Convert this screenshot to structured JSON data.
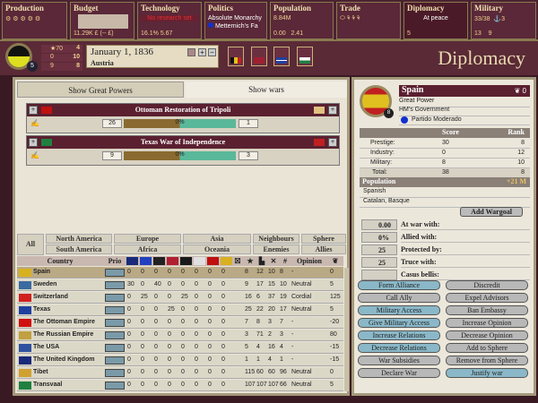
{
  "topbar": {
    "production": {
      "title": "Production"
    },
    "budget": {
      "title": "Budget",
      "value": "11.29K £ (-- £)"
    },
    "technology": {
      "title": "Technology",
      "research": "No research set",
      "literacy": "16.1%",
      "research_points": "5.67"
    },
    "politics": {
      "title": "Politics",
      "government": "Absolute Monarchy",
      "ruler": "Metternich's Fa"
    },
    "population": {
      "title": "Population",
      "total": "8.84M",
      "militancy": "0.00",
      "consciousness": "2.41"
    },
    "trade": {
      "title": "Trade"
    },
    "diplomacy": {
      "title": "Diplomacy",
      "status": "At peace",
      "diplomats": "5"
    },
    "military": {
      "title": "Military",
      "army": "33/38",
      "navy": "3",
      "brigades": "13",
      "leaders": "9"
    }
  },
  "nation": {
    "rank": "5",
    "prestige": "70",
    "prestige_rank": "4",
    "industry": "0",
    "industry_rank": "10",
    "military": "9",
    "military_rank": "8",
    "date": "January 1, 1836",
    "name": "Austria"
  },
  "screen_title": "Diplomacy",
  "tabs": [
    "Show Great Powers",
    "Show wars"
  ],
  "wars": [
    {
      "name": "Ottoman Restoration of Tripoli",
      "attackers": "26",
      "progress": "0%",
      "defenders": "1",
      "colors": [
        "#c01010",
        "#e0c080"
      ]
    },
    {
      "name": "Texas War of Independence",
      "attackers": "9",
      "progress": "0%",
      "defenders": "3",
      "colors": [
        "#208040",
        "#c02020"
      ]
    }
  ],
  "filters": {
    "all": "All",
    "north_america": "North America",
    "south_america": "South America",
    "europe": "Europe",
    "africa": "Africa",
    "asia": "Asia",
    "oceania": "Oceania",
    "neighbours": "Neighbours",
    "enemies": "Enemies",
    "sphere": "Sphere",
    "allies": "Allies"
  },
  "table": {
    "headers": {
      "country": "Country",
      "prio": "Prio",
      "opinion": "Opinion"
    },
    "gp_flag_colors": [
      "#1a2a7a",
      "#2040c0",
      "#222222",
      "#b02030",
      "#1a1a1a",
      "#e0e0e0",
      "#c01010",
      "#d8b020"
    ],
    "rows": [
      {
        "name": "Spain",
        "flag": "#d8b020",
        "vals": [
          "0",
          "0",
          "0",
          "0",
          "0",
          "0",
          "0",
          "0"
        ],
        "prestige": "8",
        "industry": "12",
        "military": "10",
        "rank": "8",
        "opinion": "-",
        "influence": "0"
      },
      {
        "name": "Sweden",
        "flag": "#3a6aa0",
        "vals": [
          "30",
          "0",
          "40",
          "0",
          "0",
          "0",
          "0",
          "0"
        ],
        "prestige": "9",
        "industry": "17",
        "military": "15",
        "rank": "10",
        "opinion": "Neutral",
        "influence": "5"
      },
      {
        "name": "Switzerland",
        "flag": "#d02020",
        "vals": [
          "0",
          "25",
          "0",
          "0",
          "25",
          "0",
          "0",
          "0"
        ],
        "prestige": "16",
        "industry": "6",
        "military": "37",
        "rank": "19",
        "opinion": "Cordial",
        "influence": "125"
      },
      {
        "name": "Texas",
        "flag": "#2040a0",
        "vals": [
          "0",
          "0",
          "0",
          "25",
          "0",
          "0",
          "0",
          "0"
        ],
        "prestige": "25",
        "industry": "22",
        "military": "20",
        "rank": "17",
        "opinion": "Neutral",
        "influence": "5"
      },
      {
        "name": "The Ottoman Empire",
        "flag": "#d01010",
        "vals": [
          "0",
          "0",
          "0",
          "0",
          "0",
          "0",
          "0",
          "0"
        ],
        "prestige": "7",
        "industry": "8",
        "military": "3",
        "rank": "7",
        "opinion": "-",
        "influence": "-20"
      },
      {
        "name": "The Russian Empire",
        "flag": "#c0a040",
        "vals": [
          "0",
          "0",
          "0",
          "0",
          "0",
          "0",
          "0",
          "0"
        ],
        "prestige": "3",
        "industry": "71",
        "military": "2",
        "rank": "3",
        "opinion": "-",
        "influence": "80"
      },
      {
        "name": "The USA",
        "flag": "#3050a0",
        "vals": [
          "0",
          "0",
          "0",
          "0",
          "0",
          "0",
          "0",
          "0"
        ],
        "prestige": "5",
        "industry": "4",
        "military": "16",
        "rank": "4",
        "opinion": "-",
        "influence": "-15"
      },
      {
        "name": "The United Kingdom",
        "flag": "#1a2a7a",
        "vals": [
          "0",
          "0",
          "0",
          "0",
          "0",
          "0",
          "0",
          "0"
        ],
        "prestige": "1",
        "industry": "1",
        "military": "4",
        "rank": "1",
        "opinion": "-",
        "influence": "-15"
      },
      {
        "name": "Tibet",
        "flag": "#d0a030",
        "vals": [
          "0",
          "0",
          "0",
          "0",
          "0",
          "0",
          "0",
          "0"
        ],
        "prestige": "115",
        "industry": "60",
        "military": "60",
        "rank": "96",
        "opinion": "Neutral",
        "influence": "0"
      },
      {
        "name": "Transvaal",
        "flag": "#208040",
        "vals": [
          "0",
          "0",
          "0",
          "0",
          "0",
          "0",
          "0",
          "0"
        ],
        "prestige": "107",
        "industry": "107",
        "military": "107",
        "rank": "66",
        "opinion": "Neutral",
        "influence": "5"
      }
    ]
  },
  "selected": {
    "name": "Spain",
    "infamy": "0",
    "rank": "8",
    "status": "Great Power",
    "government": "HM's Government",
    "party": "Partido Moderado",
    "score_header": "Score",
    "rank_header": "Rank",
    "scores": [
      {
        "label": "Prestige:",
        "score": "30",
        "rank": "8"
      },
      {
        "label": "Industry:",
        "score": "0",
        "rank": "12"
      },
      {
        "label": "Military:",
        "score": "8",
        "rank": "10"
      },
      {
        "label": "Total:",
        "score": "38",
        "rank": "8"
      }
    ],
    "population_label": "Population",
    "population": "+21 M",
    "cultures": [
      "Spanish",
      "Catalan, Basque"
    ],
    "add_wargoal": "Add Wargoal",
    "relations": [
      {
        "value": "0.00",
        "label": "At war with:"
      },
      {
        "value": "0%",
        "label": "Allied with:"
      },
      {
        "value": "25",
        "label": "Protected by:"
      },
      {
        "value": "25",
        "label": "Truce with:"
      },
      {
        "value": "",
        "label": "Casus bellis:"
      }
    ]
  },
  "actions": [
    {
      "label": "Form Alliance",
      "on": true
    },
    {
      "label": "Discredit",
      "on": false
    },
    {
      "label": "Call Ally",
      "on": false
    },
    {
      "label": "Expel Advisors",
      "on": false
    },
    {
      "label": "Military Access",
      "on": true
    },
    {
      "label": "Ban Embassy",
      "on": false
    },
    {
      "label": "Give Military Access",
      "on": true
    },
    {
      "label": "Increase Opinion",
      "on": false
    },
    {
      "label": "Increase Relations",
      "on": true
    },
    {
      "label": "Decrease Opinion",
      "on": false
    },
    {
      "label": "Decrease Relations",
      "on": true
    },
    {
      "label": "Add to Sphere",
      "on": false
    },
    {
      "label": "War Subsidies",
      "on": false
    },
    {
      "label": "Remove from Sphere",
      "on": false
    },
    {
      "label": "Declare War",
      "on": false
    },
    {
      "label": "Justify war",
      "on": true
    }
  ]
}
